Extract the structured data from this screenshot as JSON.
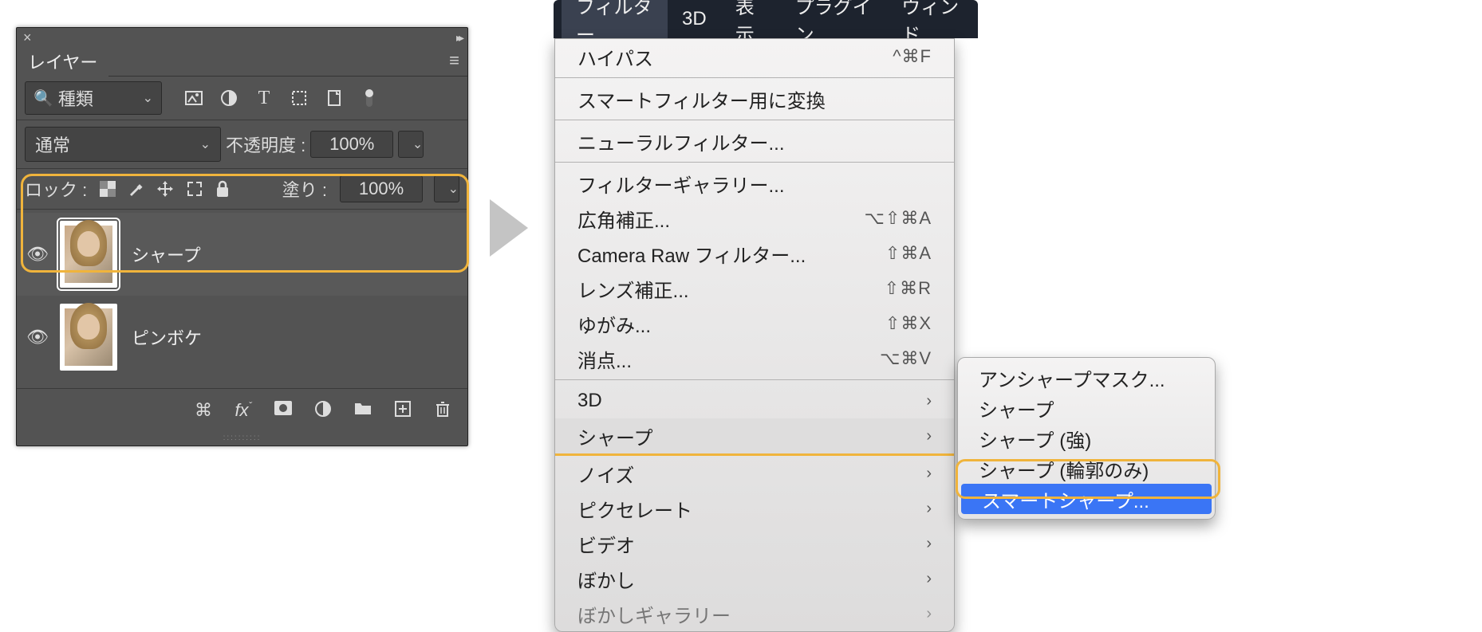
{
  "layers_panel": {
    "tab_label": "レイヤー",
    "search_label": "種類",
    "blend_mode": "通常",
    "opacity_label": "不透明度 :",
    "opacity_value": "100%",
    "lock_label": "ロック :",
    "fill_label": "塗り :",
    "fill_value": "100%",
    "layers": [
      {
        "name": "シャープ"
      },
      {
        "name": "ピンボケ"
      }
    ]
  },
  "menubar": {
    "items": [
      "フィルター",
      "3D",
      "表示",
      "プラグイン",
      "ウィンド"
    ]
  },
  "filter_menu": {
    "last_filter": {
      "label": "ハイパス",
      "shortcut": "^⌘F"
    },
    "convert_smart": "スマートフィルター用に変換",
    "neural": "ニューラルフィルター...",
    "groupA": [
      {
        "label": "フィルターギャラリー...",
        "shortcut": ""
      },
      {
        "label": "広角補正...",
        "shortcut": "⌥⇧⌘A"
      },
      {
        "label": "Camera Raw フィルター...",
        "shortcut": "⇧⌘A"
      },
      {
        "label": "レンズ補正...",
        "shortcut": "⇧⌘R"
      },
      {
        "label": "ゆがみ...",
        "shortcut": "⇧⌘X"
      },
      {
        "label": "消点...",
        "shortcut": "⌥⌘V"
      }
    ],
    "groupB": [
      "3D",
      "シャープ",
      "ノイズ",
      "ピクセレート",
      "ビデオ",
      "ぼかし",
      "ぼかしギャラリー"
    ]
  },
  "sharpen_submenu": {
    "items": [
      "アンシャープマスク...",
      "シャープ",
      "シャープ (強)",
      "シャープ (輪郭のみ)",
      "スマートシャープ..."
    ],
    "selected_index": 4
  }
}
